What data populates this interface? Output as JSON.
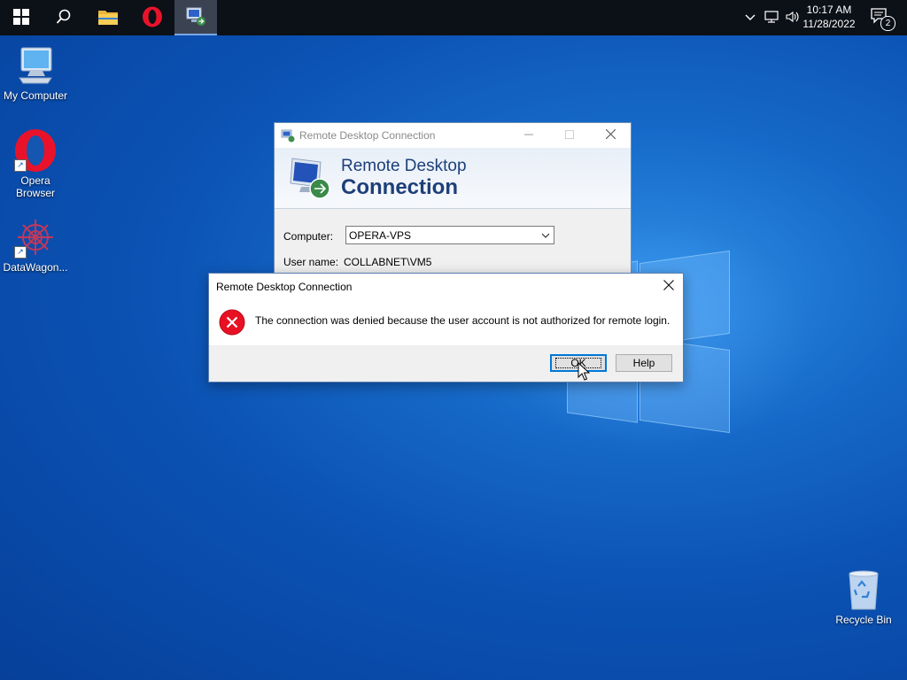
{
  "taskbar": {
    "pinned": [
      {
        "name": "start",
        "icon": "windows-logo-icon"
      },
      {
        "name": "search",
        "icon": "search-icon"
      },
      {
        "name": "file-explorer",
        "icon": "folder-icon"
      },
      {
        "name": "opera",
        "icon": "opera-icon"
      },
      {
        "name": "remote-desktop",
        "icon": "remote-desktop-icon",
        "active": true
      }
    ],
    "tray_icons": [
      "chevron-up-icon",
      "network-icon",
      "volume-icon"
    ],
    "clock": {
      "time": "10:17 AM",
      "date": "11/28/2022"
    },
    "notifications": {
      "icon": "action-center-icon",
      "count": "2"
    }
  },
  "desktop": {
    "icons": [
      {
        "label": "My Computer",
        "icon": "computer-icon"
      },
      {
        "label": "Opera Browser",
        "icon": "opera-icon",
        "shortcut": true
      },
      {
        "label": "DataWagon...",
        "icon": "datawagon-icon",
        "shortcut": true
      },
      {
        "label": "Recycle Bin",
        "icon": "recycle-bin-icon"
      }
    ]
  },
  "rdc_window": {
    "title": "Remote Desktop Connection",
    "banner": {
      "line1": "Remote Desktop",
      "line2": "Connection"
    },
    "computer": {
      "label": "Computer:",
      "value": "OPERA-VPS"
    },
    "username": {
      "label": "User name:",
      "value": "COLLABNET\\VM5"
    }
  },
  "error_dialog": {
    "title": "Remote Desktop Connection",
    "message": "The connection was denied because the user account is not authorized for remote login.",
    "icon": "error-icon",
    "buttons": {
      "ok": "OK",
      "help": "Help"
    }
  },
  "colors": {
    "desktop_blue": "#0b52b4",
    "taskbar": "#0c1017",
    "accent": "#0078d7",
    "error_red": "#e81123"
  }
}
